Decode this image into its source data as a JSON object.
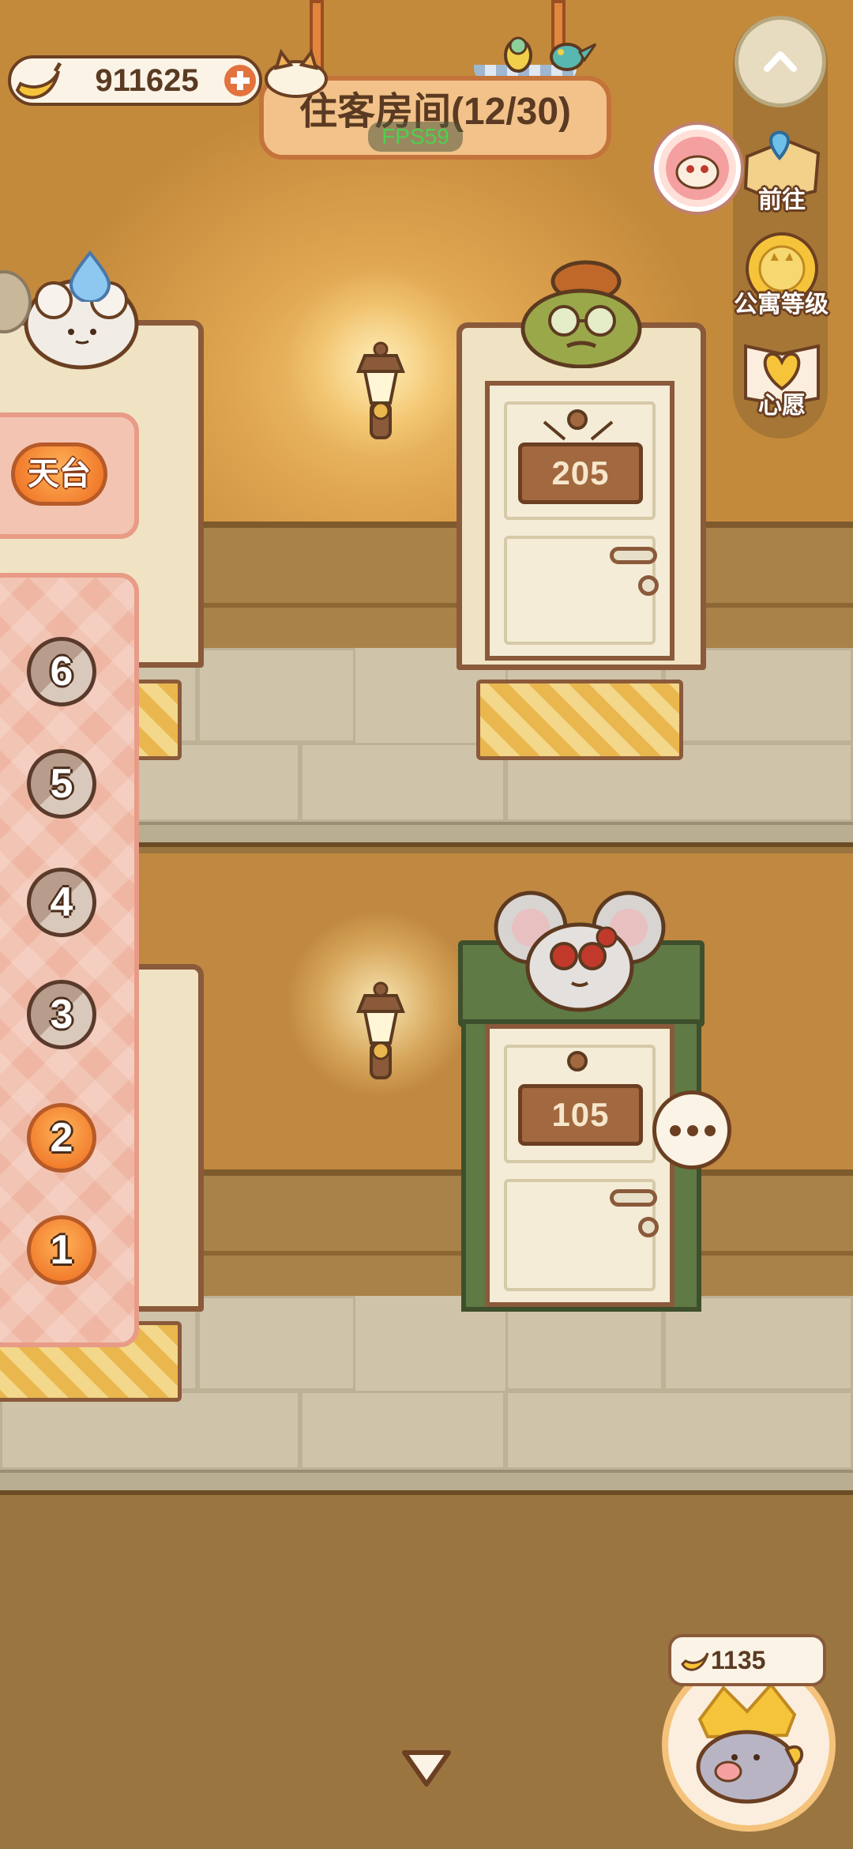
{
  "hud": {
    "currency_amount": "911625",
    "title": "住客房间(12/30)",
    "fps": "FPS59"
  },
  "side_menu": {
    "goto_label": "前往",
    "apartment_level_label": "公寓等级",
    "wish_label": "心愿"
  },
  "floor_menu": {
    "rooftop_label": "天台",
    "floors": [
      "6",
      "5",
      "4",
      "3",
      "2",
      "1"
    ]
  },
  "rooms": {
    "upper_room_number": "205",
    "lower_room_number": "105"
  },
  "piggy_bank": {
    "amount": "1135"
  },
  "colors": {
    "accent_orange": "#f07a2a",
    "wood_brown": "#6b3f22",
    "panel_pink": "#efb7a3"
  }
}
